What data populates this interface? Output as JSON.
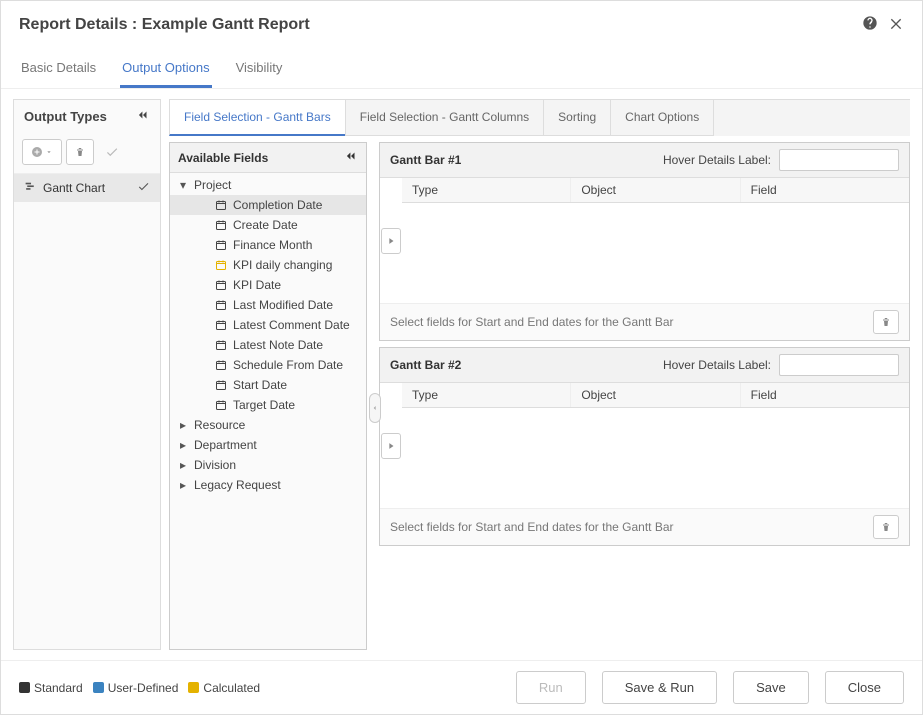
{
  "header": {
    "title": "Report Details : Example Gantt Report"
  },
  "main_tabs": {
    "basic": "Basic Details",
    "output": "Output Options",
    "visibility": "Visibility",
    "active": "output"
  },
  "output_types": {
    "title": "Output Types",
    "items": [
      {
        "label": "Gantt Chart",
        "checked": true
      }
    ]
  },
  "sub_tabs": {
    "gantt_bars": "Field Selection - Gantt Bars",
    "gantt_cols": "Field Selection - Gantt Columns",
    "sorting": "Sorting",
    "chart_options": "Chart Options",
    "active": "gantt_bars"
  },
  "available_fields": {
    "title": "Available Fields",
    "groups": [
      {
        "key": "project",
        "label": "Project",
        "expanded": true,
        "children": [
          {
            "label": "Completion Date",
            "calc": false,
            "selected": true
          },
          {
            "label": "Create Date",
            "calc": false
          },
          {
            "label": "Finance Month",
            "calc": false
          },
          {
            "label": "KPI daily changing",
            "calc": true
          },
          {
            "label": "KPI Date",
            "calc": false
          },
          {
            "label": "Last Modified Date",
            "calc": false
          },
          {
            "label": "Latest Comment Date",
            "calc": false
          },
          {
            "label": "Latest Note Date",
            "calc": false
          },
          {
            "label": "Schedule From Date",
            "calc": false
          },
          {
            "label": "Start Date",
            "calc": false
          },
          {
            "label": "Target Date",
            "calc": false
          }
        ]
      },
      {
        "key": "resource",
        "label": "Resource",
        "expanded": false
      },
      {
        "key": "department",
        "label": "Department",
        "expanded": false
      },
      {
        "key": "division",
        "label": "Division",
        "expanded": false
      },
      {
        "key": "legacy",
        "label": "Legacy Request",
        "expanded": false
      }
    ]
  },
  "gantt_bars": [
    {
      "title": "Gantt Bar #1",
      "hover_label_label": "Hover Details Label:",
      "hover_label_value": "",
      "columns": {
        "type": "Type",
        "object": "Object",
        "field": "Field"
      },
      "footer": "Select fields for Start and End dates for the Gantt Bar"
    },
    {
      "title": "Gantt Bar #2",
      "hover_label_label": "Hover Details Label:",
      "hover_label_value": "",
      "columns": {
        "type": "Type",
        "object": "Object",
        "field": "Field"
      },
      "footer": "Select fields for Start and End dates for the Gantt Bar"
    }
  ],
  "legend": {
    "standard": "Standard",
    "user_defined": "User-Defined",
    "calculated": "Calculated"
  },
  "footer": {
    "run": "Run",
    "save_run": "Save & Run",
    "save": "Save",
    "close": "Close"
  }
}
